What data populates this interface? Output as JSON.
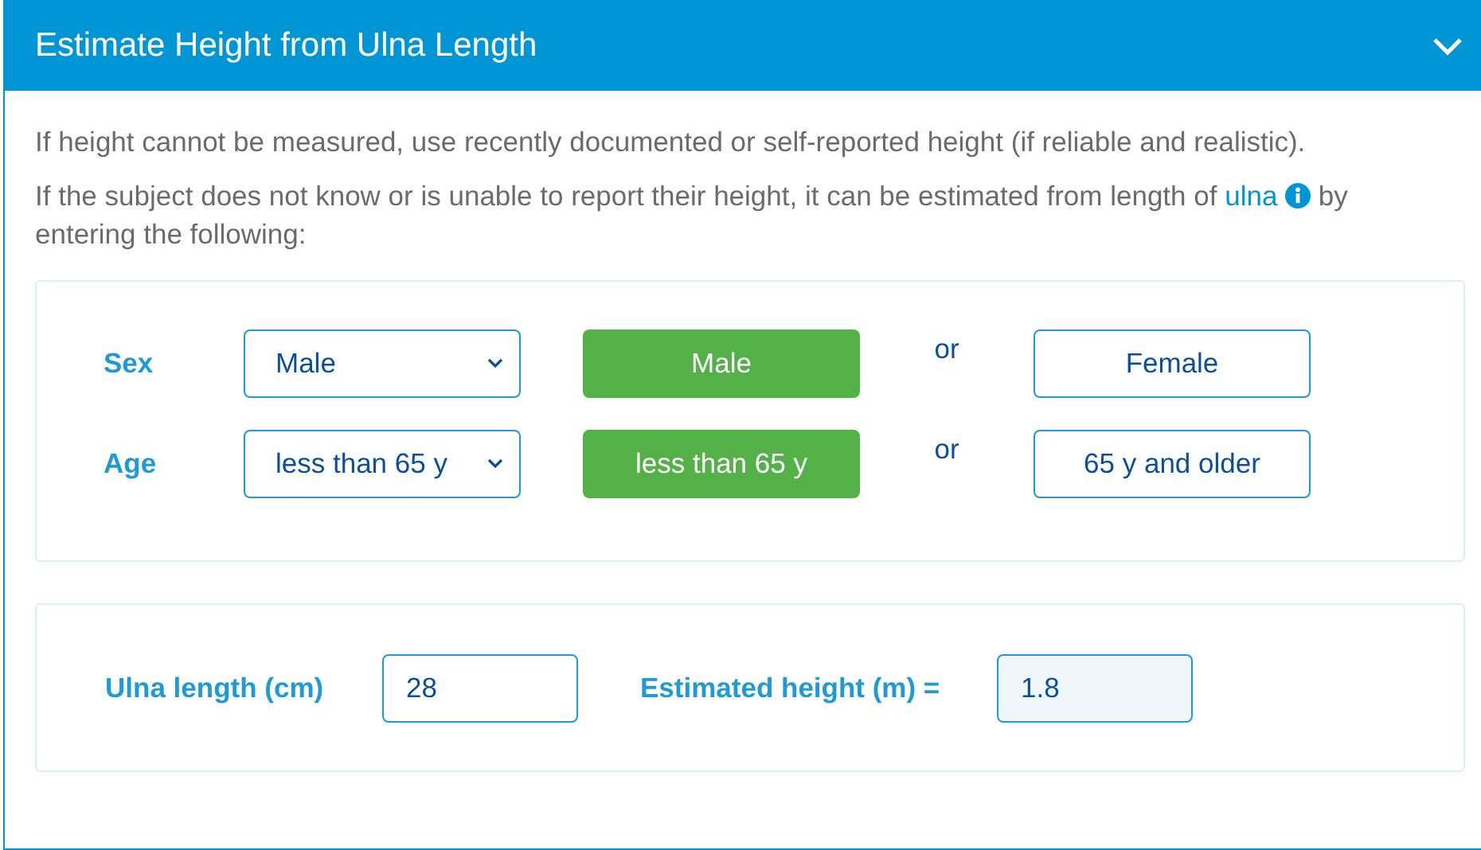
{
  "panel": {
    "title": "Estimate Height from Ulna Length",
    "expanded": true
  },
  "paragraphs": [
    {
      "text": "If height cannot be measured, use recently documented or self-reported height (if reliable and realistic)."
    },
    {
      "text": "If the subject does not know or is unable to report their height, it can be estimated from length of",
      "link": "ulna",
      "after": "by entering the following:"
    }
  ],
  "selectors": [
    {
      "label": "Sex",
      "value": "Male",
      "separator": "or",
      "options": [
        {
          "label": "Male",
          "selected": true
        },
        {
          "label": "Female",
          "selected": false
        }
      ]
    },
    {
      "label": "Age",
      "value": "less than 65 y",
      "separator": "or",
      "options": [
        {
          "label": "less than 65 y",
          "selected": true
        },
        {
          "label": "65 y and older",
          "selected": false
        }
      ]
    }
  ],
  "calculation": {
    "input_label": "Ulna length (cm)",
    "input_value": "28",
    "result_label": "Estimated height (m) =",
    "result_value": "1.8"
  }
}
